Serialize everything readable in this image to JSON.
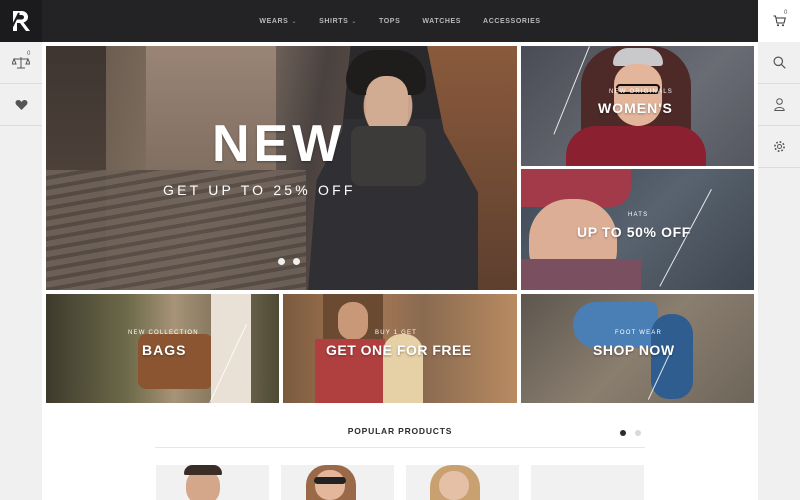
{
  "header": {
    "logo_text": "R",
    "nav": [
      {
        "label": "WEARS",
        "has_dropdown": true
      },
      {
        "label": "SHIRTS",
        "has_dropdown": true
      },
      {
        "label": "TOPS",
        "has_dropdown": false
      },
      {
        "label": "WATCHES",
        "has_dropdown": false
      },
      {
        "label": "ACCESSORIES",
        "has_dropdown": false
      }
    ],
    "cart_count": "0"
  },
  "left_rail": {
    "compare_count": "0"
  },
  "hero": {
    "title": "NEW",
    "subtitle": "GET UP TO 25% OFF",
    "slides": 2
  },
  "banners": {
    "womens": {
      "small": "NEW ORIGINALS",
      "big": "WOMEN'S"
    },
    "hats": {
      "small": "HATS",
      "big": "UP TO 50% OFF"
    },
    "bags": {
      "small": "NEW COLLECTION",
      "big": "BAGS"
    },
    "buy": {
      "small": "BUY 1 GET",
      "big": "GET ONE FOR FREE"
    },
    "shoes": {
      "small": "FOOT WEAR",
      "big": "SHOP NOW"
    }
  },
  "products": {
    "title": "POPULAR PRODUCTS",
    "pages": 2,
    "active_page": 1
  },
  "colors": {
    "header_bg": "#232325",
    "rail_bg": "#f0f0f1",
    "text_dark": "#2b2b2e"
  }
}
